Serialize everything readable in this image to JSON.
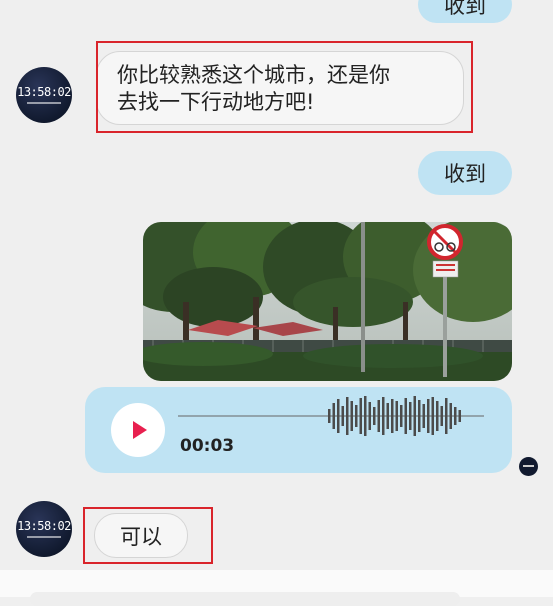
{
  "messages": {
    "top_received_label": "收到",
    "incoming_text_line1": "你比较熟悉这个城市，还是你",
    "incoming_text_line2": "去找一下行动地方吧!",
    "received_label": "收到",
    "voice_duration": "00:03",
    "reply_label": "可以"
  },
  "avatar": {
    "time_text": "13:58:02"
  },
  "colors": {
    "bubble_right": "#bfe3f3",
    "bubble_left": "#f6f6f6",
    "highlight": "#d9242b",
    "play_icon": "#e8204f"
  },
  "icons": [
    "play-icon",
    "waveform-icon",
    "no-bicycle-sign-icon"
  ]
}
